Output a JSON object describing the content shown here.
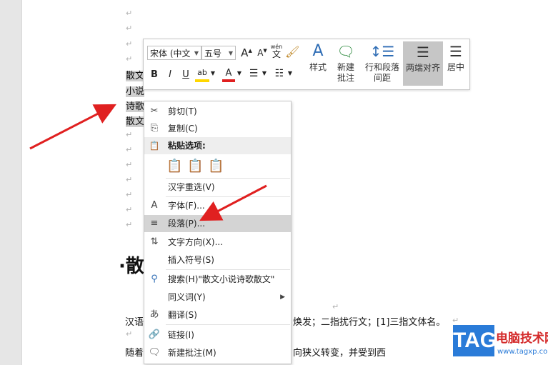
{
  "document": {
    "selected_lines": [
      "散文",
      "小说",
      "诗歌",
      "散文"
    ],
    "heading": "·散",
    "body_line1_left": "汉语",
    "body_line1_right": "焕发；二指扰行文；[1]三指文体名。",
    "body_line2_left": "随着",
    "body_line2_right": "向狭义转变，并受到西",
    "paragraph_mark": "↵"
  },
  "mini_toolbar": {
    "font_name": "宋体 (中文",
    "font_size": "五号",
    "grow_font": "A",
    "shrink_font": "A",
    "phonetic": "wén",
    "phonetic_char": "文",
    "bold": "B",
    "italic": "I",
    "underline": "U",
    "highlight": "ab",
    "font_color": "A",
    "styles_label": "样式",
    "new_comment_label_1": "新建",
    "new_comment_label_2": "批注",
    "line_spacing_label_1": "行和段落",
    "line_spacing_label_2": "间距",
    "justify_label": "两端对齐",
    "center_label": "居中"
  },
  "context_menu": {
    "cut": "剪切(T)",
    "copy": "复制(C)",
    "paste_options": "粘贴选项:",
    "reconvert": "汉字重选(V)",
    "font": "字体(F)...",
    "paragraph": "段落(P)...",
    "text_direction": "文字方向(X)...",
    "insert_symbol": "插入符号(S)",
    "search": "搜索(H)\"散文小说诗歌散文\"",
    "synonyms": "同义词(Y)",
    "translate": "翻译(S)",
    "link": "链接(I)",
    "new_comment": "新建批注(M)"
  },
  "watermark": {
    "tag": "TAG",
    "title": "电脑技术网",
    "url": "www.tagxp.com"
  },
  "colors": {
    "highlight_yellow": "#ffd700",
    "font_color_red": "#e02020",
    "arrow_red": "#e02020",
    "menu_highlight": "#d4d4d4",
    "watermark_blue": "#2a7bd8"
  }
}
